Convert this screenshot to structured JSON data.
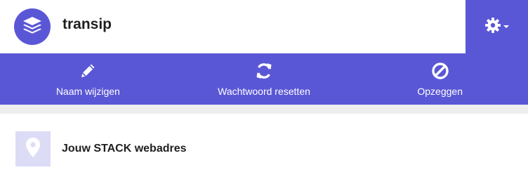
{
  "header": {
    "logo_icon": "layers-icon",
    "title": "transip",
    "settings_icon": "gear-icon"
  },
  "actions": [
    {
      "icon": "pencil-icon",
      "label": "Naam wijzigen"
    },
    {
      "icon": "refresh-icon",
      "label": "Wachtwoord resetten"
    },
    {
      "icon": "ban-icon",
      "label": "Opzeggen"
    }
  ],
  "item": {
    "icon": "map-marker-icon",
    "label": "Jouw STACK webadres"
  },
  "colors": {
    "accent": "#5a57d6",
    "accent_light": "#dcdcf7",
    "divider": "#eeeeee",
    "text": "#1f1f1f"
  }
}
